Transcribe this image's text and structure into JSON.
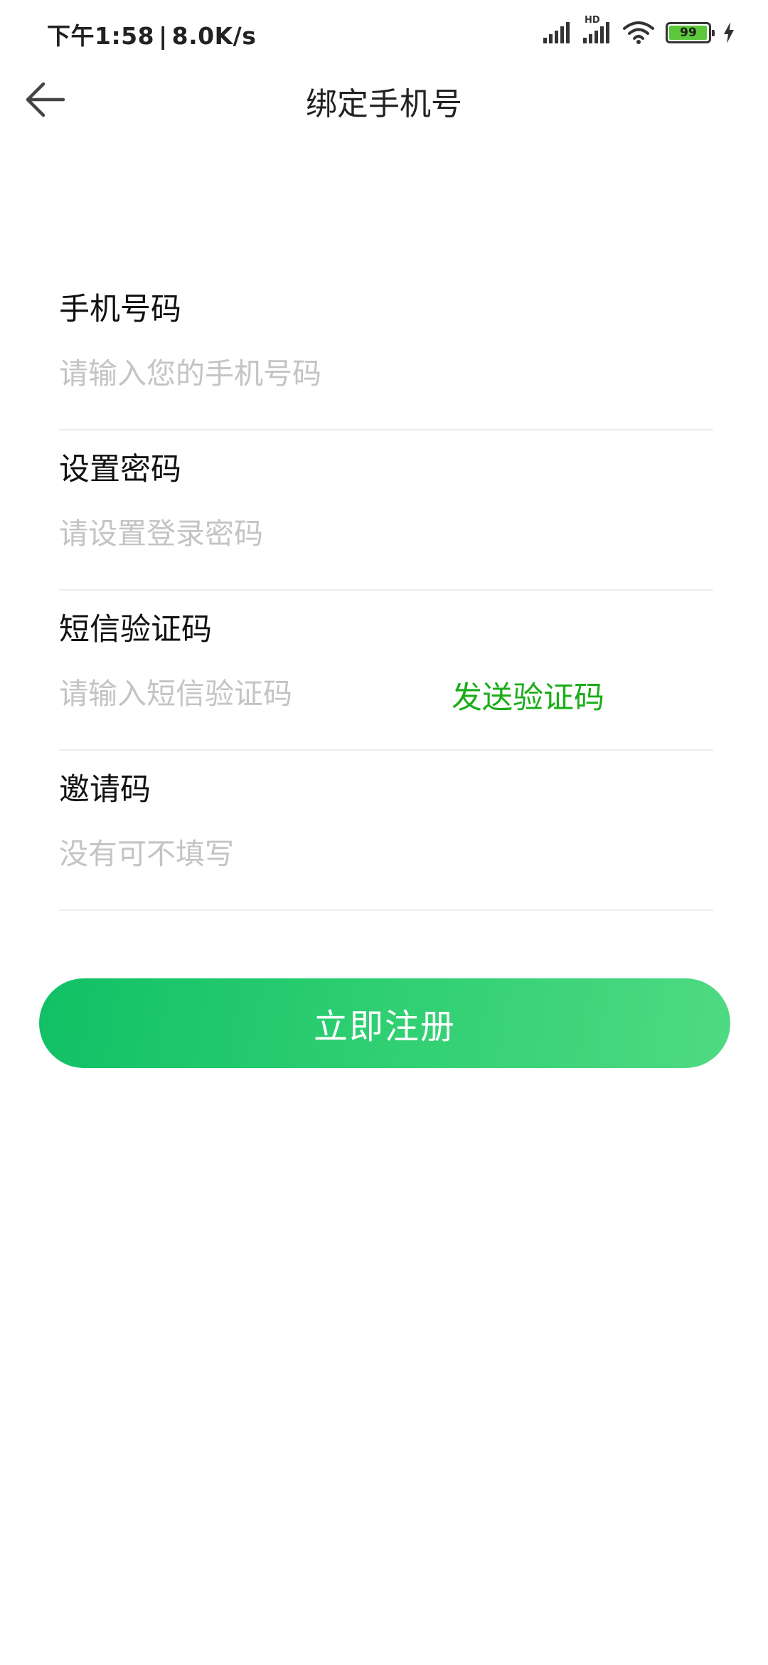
{
  "status_bar": {
    "time": "下午1:58",
    "separator": "|",
    "net_speed": "8.0K/s",
    "hd_label": "HD",
    "battery_level": "99",
    "battery_fraction": 0.99,
    "battery_color": "#5cc93c",
    "icons": [
      "signal-icon",
      "hd-signal-icon",
      "wifi-icon",
      "battery-icon",
      "charging-icon"
    ]
  },
  "header": {
    "title": "绑定手机号",
    "back_icon": "back-arrow-icon"
  },
  "form": {
    "phone": {
      "label": "手机号码",
      "value": "",
      "placeholder": "请输入您的手机号码"
    },
    "password": {
      "label": "设置密码",
      "value": "",
      "placeholder": "请设置登录密码"
    },
    "sms_code": {
      "label": "短信验证码",
      "value": "",
      "placeholder": "请输入短信验证码",
      "send_label": "发送验证码"
    },
    "invite_code": {
      "label": "邀请码",
      "value": "",
      "placeholder": "没有可不填写"
    }
  },
  "register_button": {
    "label": "立即注册"
  },
  "colors": {
    "accent": "#1aad19",
    "button_gradient_start": "#11c065",
    "button_gradient_end": "#4fda82",
    "placeholder": "#c4c4c4",
    "divider": "#ececec"
  }
}
